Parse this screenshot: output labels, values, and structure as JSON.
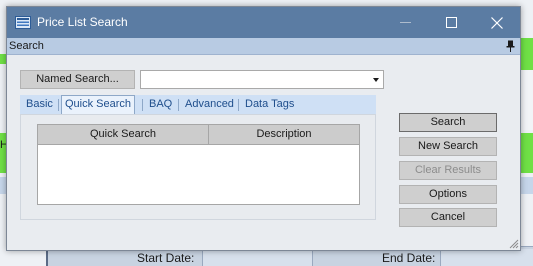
{
  "window": {
    "title": "Price List Search",
    "title_icon": "price-list-window-icon",
    "controls": {
      "minimize": "minimize-icon",
      "maximize": "maximize-icon",
      "close": "close-icon"
    }
  },
  "panel": {
    "header": "Search",
    "pin_icon": "pin-icon"
  },
  "named_search": {
    "button_label": "Named Search...",
    "value": ""
  },
  "tabs": [
    {
      "label": "Basic",
      "active": false
    },
    {
      "label": "Quick Search",
      "active": true
    },
    {
      "label": "BAQ",
      "active": false
    },
    {
      "label": "Advanced",
      "active": false
    },
    {
      "label": "Data Tags",
      "active": false
    }
  ],
  "grid": {
    "columns": [
      "Quick Search",
      "Description"
    ],
    "rows": []
  },
  "buttons": {
    "search": "Search",
    "new_search": "New Search",
    "clear_results": "Clear Results",
    "options": "Options",
    "cancel": "Cancel"
  },
  "background": {
    "start_date_label": "Start Date:",
    "end_date_label": "End Date:",
    "edge_char": "H"
  },
  "colors": {
    "titlebar": "#5b7ca3",
    "panel_header": "#b8cbe3",
    "tab_strip": "#cfe0f5",
    "background_accent": "#6fe046"
  }
}
